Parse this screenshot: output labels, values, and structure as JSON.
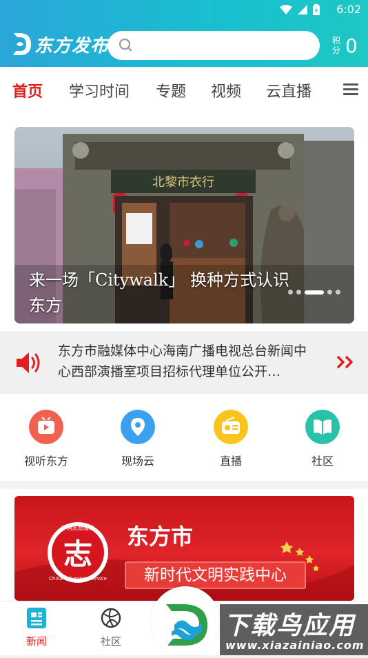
{
  "status_bar": {
    "time": "6:02",
    "icons": [
      "wifi-icon",
      "signal-icon",
      "battery-icon"
    ]
  },
  "header": {
    "app_name": "东方发布",
    "search": {
      "placeholder": "",
      "icon": "search-icon"
    },
    "points": {
      "label": "积分",
      "value": "0"
    }
  },
  "tabs": [
    {
      "label": "首页",
      "active": true
    },
    {
      "label": "学习时间",
      "active": false
    },
    {
      "label": "专题",
      "active": false
    },
    {
      "label": "视频",
      "active": false
    },
    {
      "label": "云直播",
      "active": false
    }
  ],
  "banner": {
    "caption": "来一场「Citywalk」 换种方式认识东方",
    "slide_index": 3,
    "slide_count": 5,
    "sign_text": "北黎市衣行"
  },
  "notice": {
    "text": "东方市融媒体中心海南广播电视总台新闻中心西部演播室项目招标代理单位公开…"
  },
  "shortcuts": [
    {
      "label": "视听东方",
      "icon": "tv-icon",
      "color": "#f0614f"
    },
    {
      "label": "现场云",
      "icon": "location-pin-icon",
      "color": "#3aa0ef"
    },
    {
      "label": "直播",
      "icon": "radio-icon",
      "color": "#f9c51c"
    },
    {
      "label": "社区",
      "icon": "book-icon",
      "color": "#27c2a8"
    }
  ],
  "promo": {
    "title": "东方市",
    "subtitle": "新时代文明实践中心",
    "badge_text": "China Volunteer Service",
    "badge_top": "中国志愿服务",
    "badge_char": "志"
  },
  "bottom_nav": [
    {
      "label": "新闻",
      "icon": "news-icon",
      "active": true
    },
    {
      "label": "社区",
      "icon": "community-icon",
      "active": false
    }
  ],
  "watermark": {
    "big": "下载鸟应用",
    "small": "www.xiazainiao.com"
  },
  "colors": {
    "header_start": "#2aa6d8",
    "header_end": "#1ec8c4",
    "accent_red": "#e02020"
  }
}
